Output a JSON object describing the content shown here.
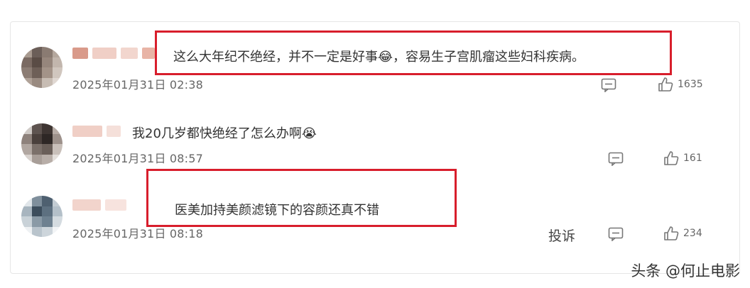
{
  "comments": [
    {
      "text": "这么大年纪不绝经，并不一定是好事😂，容易生子宫肌瘤这些妇科疾病。",
      "time": "2025年01月31日 02:38",
      "likes": "1635"
    },
    {
      "text": "我20几岁都快绝经了怎么办啊😭",
      "time": "2025年01月31日 08:57",
      "likes": "161"
    },
    {
      "text": "医美加持美颜滤镜下的容颜还真不错",
      "time": "2025年01月31日 08:18",
      "likes": "234",
      "report_label": "投诉"
    }
  ],
  "watermark": "头条 @何止电影",
  "colors": {
    "highlight": "#d81e2c",
    "text": "#333333",
    "meta": "#666666"
  },
  "icons": {
    "reply": "comment-bubble-icon",
    "like": "thumbs-up-icon"
  }
}
